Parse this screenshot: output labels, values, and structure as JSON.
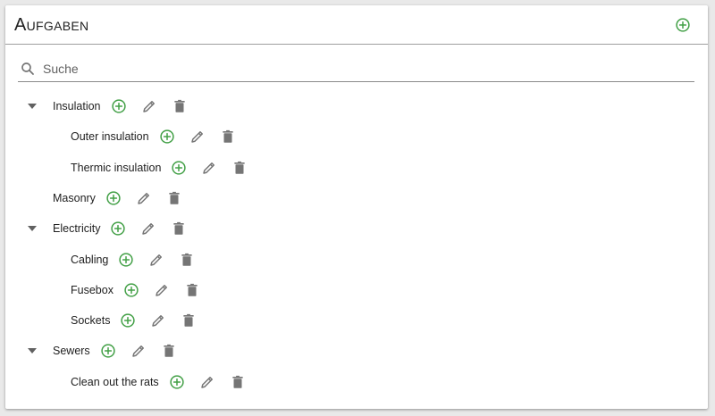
{
  "panel": {
    "title": "Aufgaben",
    "add_icon": "add-circle-outline-icon"
  },
  "search": {
    "placeholder": "Suche",
    "value": "",
    "icon": "search-icon"
  },
  "colors": {
    "accent": "#43a047",
    "icon_gray": "#757575"
  },
  "tasks": [
    {
      "label": "Insulation",
      "level": 0,
      "expanded": true
    },
    {
      "label": "Outer insulation",
      "level": 1
    },
    {
      "label": "Thermic insulation",
      "level": 1
    },
    {
      "label": "Masonry",
      "level": 0
    },
    {
      "label": "Electricity",
      "level": 0,
      "expanded": true
    },
    {
      "label": "Cabling",
      "level": 1
    },
    {
      "label": "Fusebox",
      "level": 1
    },
    {
      "label": "Sockets",
      "level": 1
    },
    {
      "label": "Sewers",
      "level": 0,
      "expanded": true
    },
    {
      "label": "Clean out the rats",
      "level": 1
    }
  ]
}
